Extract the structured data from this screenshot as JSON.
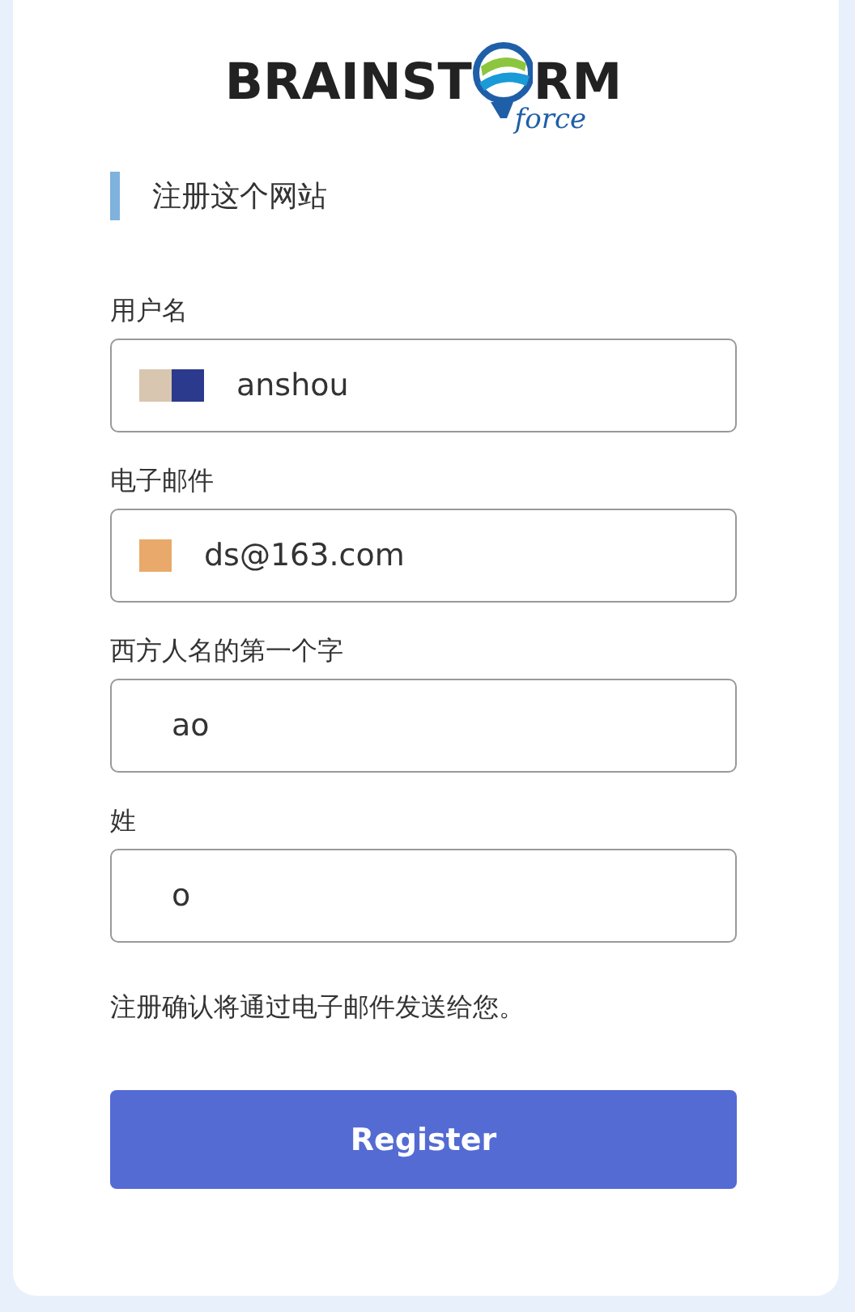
{
  "logo": {
    "left": "BRAINST",
    "right": "RM",
    "sub": "force"
  },
  "heading": "注册这个网站",
  "fields": [
    {
      "label": "用户名",
      "value": "anshou",
      "redactions": [
        {
          "color": "#d9c6b0"
        },
        {
          "color": "#2b3a8c"
        }
      ]
    },
    {
      "label": "电子邮件",
      "value": "ds@163.com",
      "redactions": [
        {
          "color": "#e8a96a"
        }
      ]
    },
    {
      "label": "西方人名的第一个字",
      "value": "ao"
    },
    {
      "label": "姓",
      "value": "o"
    }
  ],
  "note": "注册确认将通过电子邮件发送给您。",
  "button": "Register"
}
